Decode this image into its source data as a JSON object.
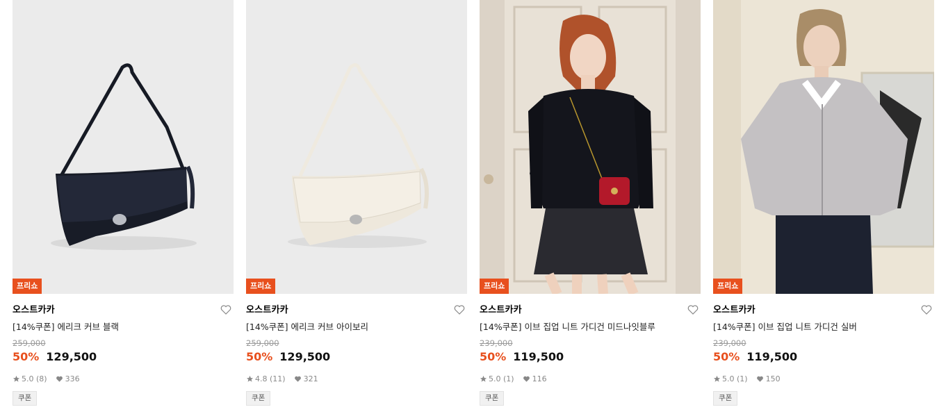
{
  "products": [
    {
      "badge": "프리쇼",
      "brand": "오스트카카",
      "title": "[14%쿠폰] 에리크 커브 블랙",
      "original_price": "259,000",
      "discount": "50%",
      "price": "129,500",
      "rating": "5.0",
      "reviews": "(8)",
      "likes": "336",
      "tag": "쿠폰",
      "image": "black-shoulder-bag"
    },
    {
      "badge": "프리쇼",
      "brand": "오스트카카",
      "title": "[14%쿠폰] 에리크 커브 아이보리",
      "original_price": "259,000",
      "discount": "50%",
      "price": "129,500",
      "rating": "4.8",
      "reviews": "(11)",
      "likes": "321",
      "tag": "쿠폰",
      "image": "ivory-shoulder-bag"
    },
    {
      "badge": "프리쇼",
      "brand": "오스트카카",
      "title": "[14%쿠폰] 이브 집업 니트 가디건 미드나잇블루",
      "original_price": "239,000",
      "discount": "50%",
      "price": "119,500",
      "rating": "5.0",
      "reviews": "(1)",
      "likes": "116",
      "tag": "쿠폰",
      "image": "model-navy-cardigan"
    },
    {
      "badge": "프리쇼",
      "brand": "오스트카카",
      "title": "[14%쿠폰] 이브 집업 니트 가디건 실버",
      "original_price": "239,000",
      "discount": "50%",
      "price": "119,500",
      "rating": "5.0",
      "reviews": "(1)",
      "likes": "150",
      "tag": "쿠폰",
      "image": "model-silver-cardigan"
    }
  ],
  "colors": {
    "accent": "#e8501e",
    "muted": "#9a9a9a"
  }
}
